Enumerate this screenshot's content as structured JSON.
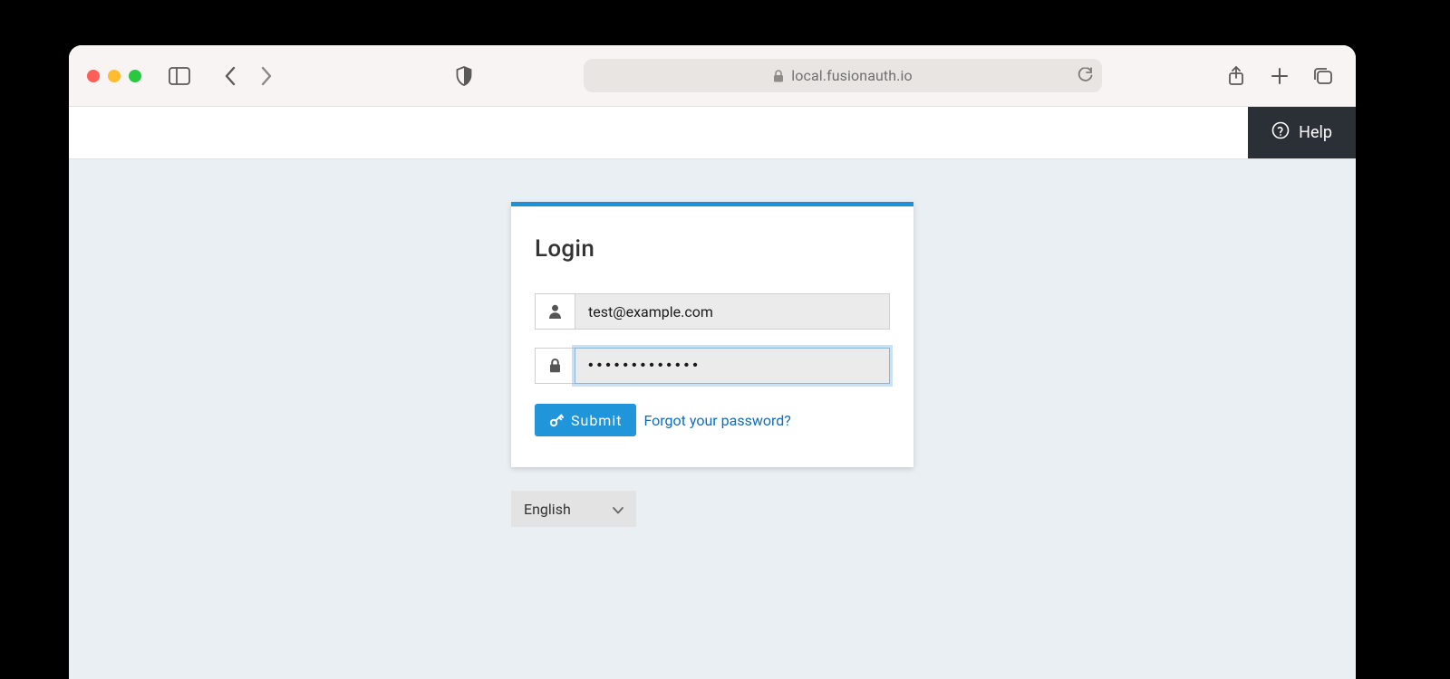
{
  "browser": {
    "url": "local.fusionauth.io"
  },
  "app": {
    "help_label": "Help"
  },
  "login": {
    "title": "Login",
    "email": {
      "value": "test@example.com"
    },
    "password": {
      "value": "•••••••••••••"
    },
    "submit_label": "Submit",
    "forgot_label": "Forgot your password?"
  },
  "lang": {
    "selected": "English"
  },
  "colors": {
    "accent": "#2095d9",
    "page_bg": "#e9eff3"
  }
}
